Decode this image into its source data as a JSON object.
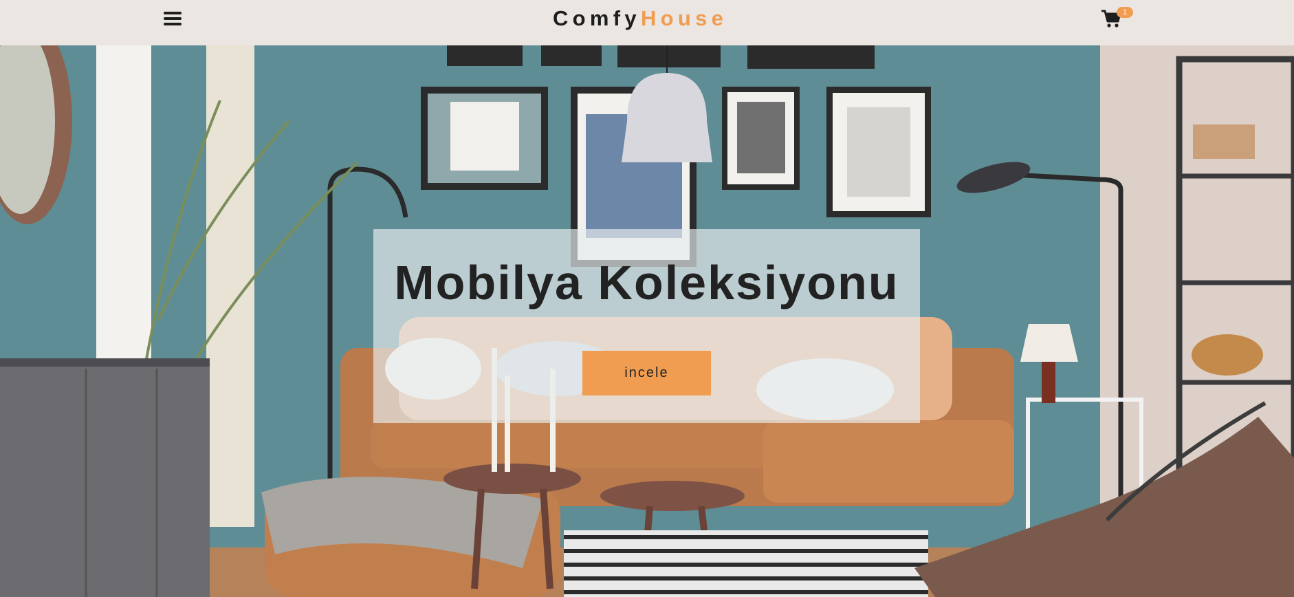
{
  "navbar": {
    "menu_icon": "hamburger-icon",
    "logo": {
      "primary": "Comfy",
      "accent": "House"
    },
    "cart_icon": "shopping-cart-icon",
    "cart_count": "1",
    "background": "#ebe6e1",
    "accent_color": "#f09d51"
  },
  "hero": {
    "image_subject": "living room with leather sofa",
    "banner": {
      "title": "Mobilya Koleksiyonu",
      "button_label": "incele"
    }
  }
}
